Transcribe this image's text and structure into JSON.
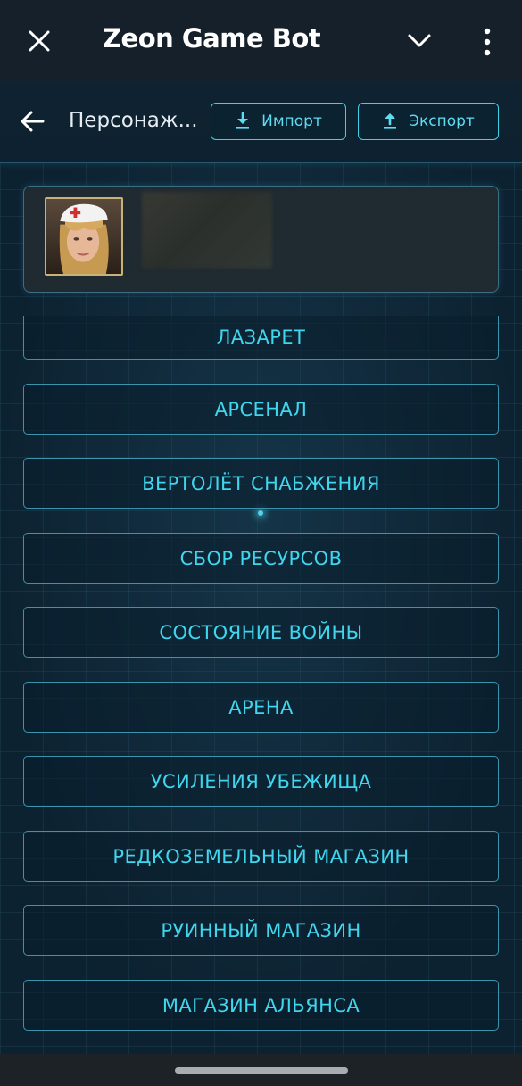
{
  "app_bar": {
    "title": "Zeon Game Bot",
    "icons": {
      "close": "close-icon",
      "collapse": "chevron-down-icon",
      "more": "more-vert-icon"
    }
  },
  "header": {
    "title": "Персонаж...",
    "import_label": "Импорт",
    "export_label": "Экспорт",
    "icons": {
      "back": "arrow-left-icon",
      "import": "download-icon",
      "export": "upload-icon"
    }
  },
  "profile": {
    "avatar": "nurse-avatar"
  },
  "menu": [
    {
      "label": "ЛАЗАРЕТ"
    },
    {
      "label": "АРСЕНАЛ"
    },
    {
      "label": "ВЕРТОЛЁТ СНАБЖЕНИЯ"
    },
    {
      "label": "СБОР РЕСУРСОВ"
    },
    {
      "label": "СОСТОЯНИЕ ВОЙНЫ"
    },
    {
      "label": "АРЕНА"
    },
    {
      "label": "УСИЛЕНИЯ УБЕЖИЩА"
    },
    {
      "label": "РЕДКОЗЕМЕЛЬНЫЙ МАГАЗИН"
    },
    {
      "label": "РУИННЫЙ МАГАЗИН"
    },
    {
      "label": "МАГАЗИН АЛЬЯНСА"
    }
  ],
  "colors": {
    "accent": "#3fd6ee",
    "app_bar_bg": "#15202b",
    "background": "#0d2231"
  }
}
